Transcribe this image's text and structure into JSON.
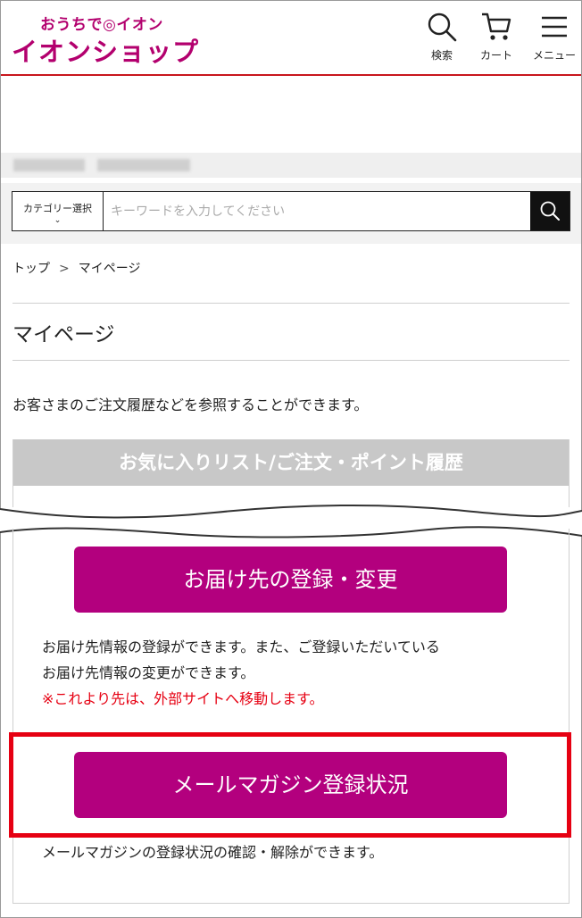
{
  "header": {
    "logo_small": "おうちで◎イオン",
    "logo_big": "イオンショップ",
    "search_label": "検索",
    "cart_label": "カート",
    "menu_label": "メニュー",
    "brand_color": "#b3006e",
    "accent_line": "#c8161d"
  },
  "search": {
    "category_label": "カテゴリー選択",
    "category_chevron": "⌄",
    "placeholder": "キーワードを入力してください"
  },
  "breadcrumb": {
    "home": "トップ",
    "separator": ">",
    "current": "マイページ"
  },
  "page": {
    "title": "マイページ",
    "intro": "お客さまのご注文履歴などを参照することができます。"
  },
  "section": {
    "heading": "お気に入りリスト/ご注文・ポイント履歴"
  },
  "address": {
    "button_label": "お届け先の登録・変更",
    "desc_line1": "お届け先情報の登録ができます。また、ご登録いただいている",
    "desc_line2": "お届け先情報の変更ができます。",
    "warning": "※これより先は、外部サイトへ移動します。"
  },
  "mailmag": {
    "button_label": "メールマガジン登録状況",
    "desc": "メールマガジンの登録状況の確認・解除ができます。"
  },
  "colors": {
    "button": "#b3007e",
    "highlight": "#e60012",
    "section_head": "#c8c8c8"
  }
}
